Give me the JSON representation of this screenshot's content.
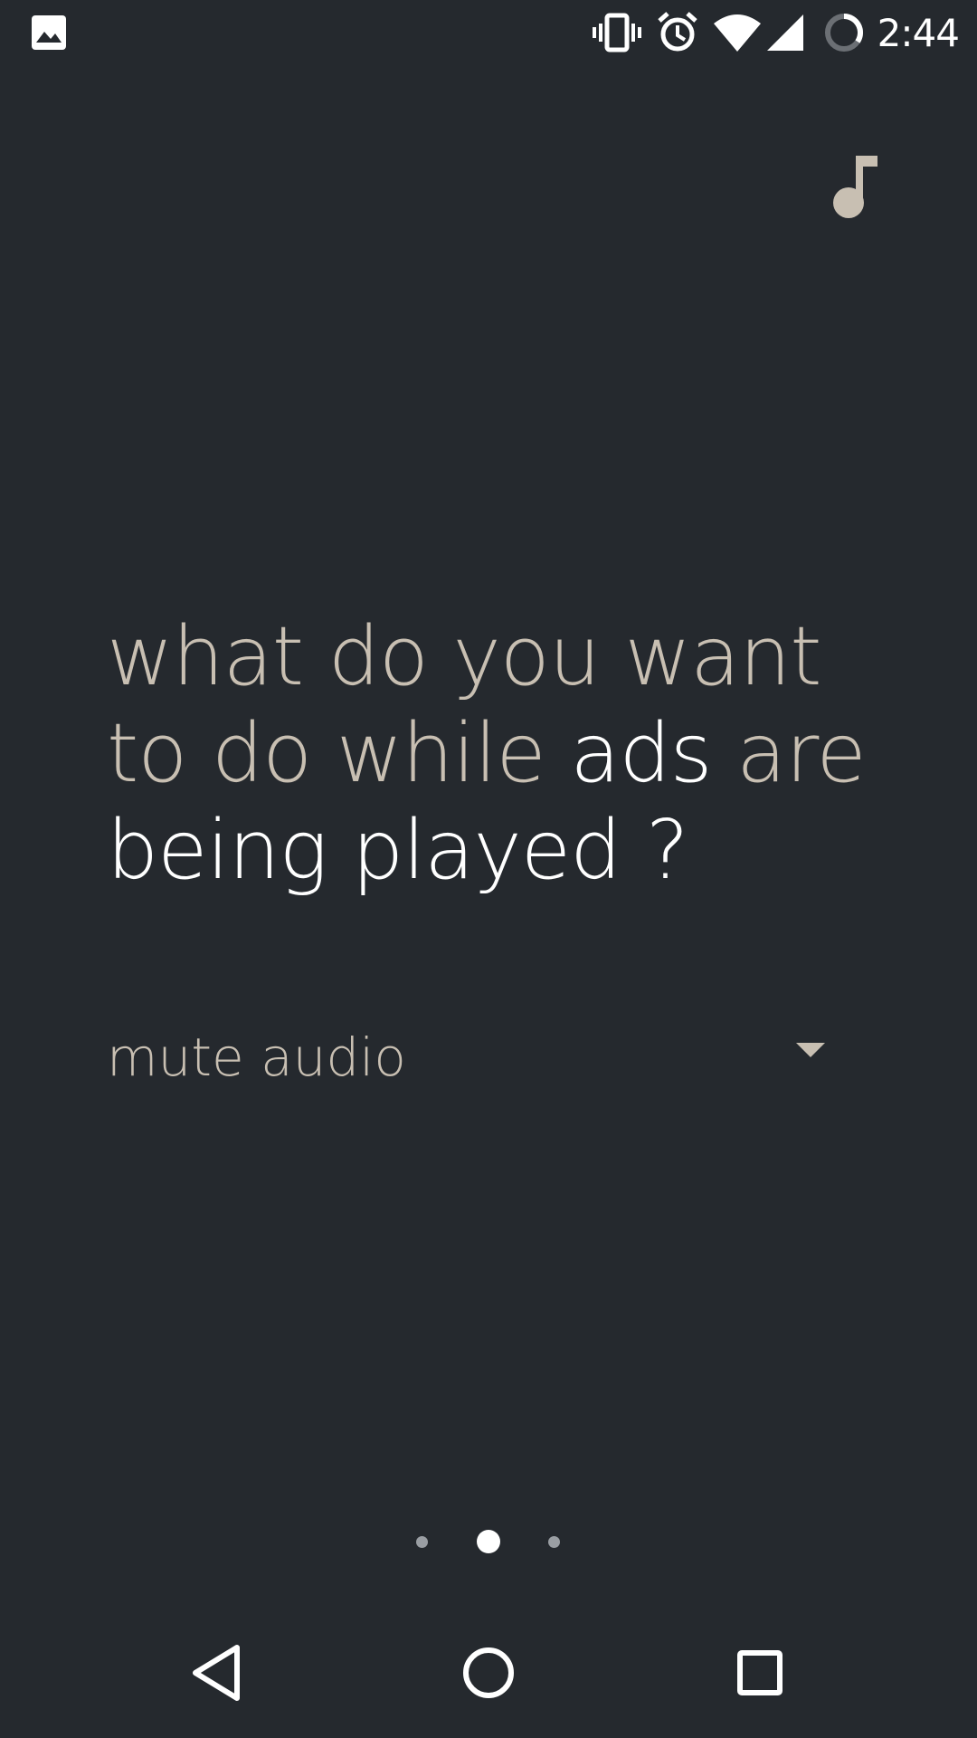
{
  "status_bar": {
    "time": "2:44",
    "left_icon": "image-notification-icon",
    "icons": [
      "vibrate-icon",
      "alarm-icon",
      "wifi-icon",
      "cell-signal-icon",
      "battery-charging-icon"
    ]
  },
  "header": {
    "icon": "music-note-icon"
  },
  "question": {
    "line1": "what do you want",
    "line2_part1": "to do while ",
    "line2_part2": "ads",
    "line2_part3": " are",
    "line3": "being played ?"
  },
  "dropdown": {
    "value": "mute audio",
    "icon": "dropdown-arrow-icon"
  },
  "pager": {
    "count": 3,
    "active_index": 1
  },
  "nav_bar": {
    "buttons": [
      "back-icon",
      "home-icon",
      "recents-icon"
    ]
  },
  "colors": {
    "background": "#25292e",
    "muted_text": "#c8bfb2",
    "highlight_text": "#ffffff",
    "accent_icon": "#c8bfb2"
  }
}
